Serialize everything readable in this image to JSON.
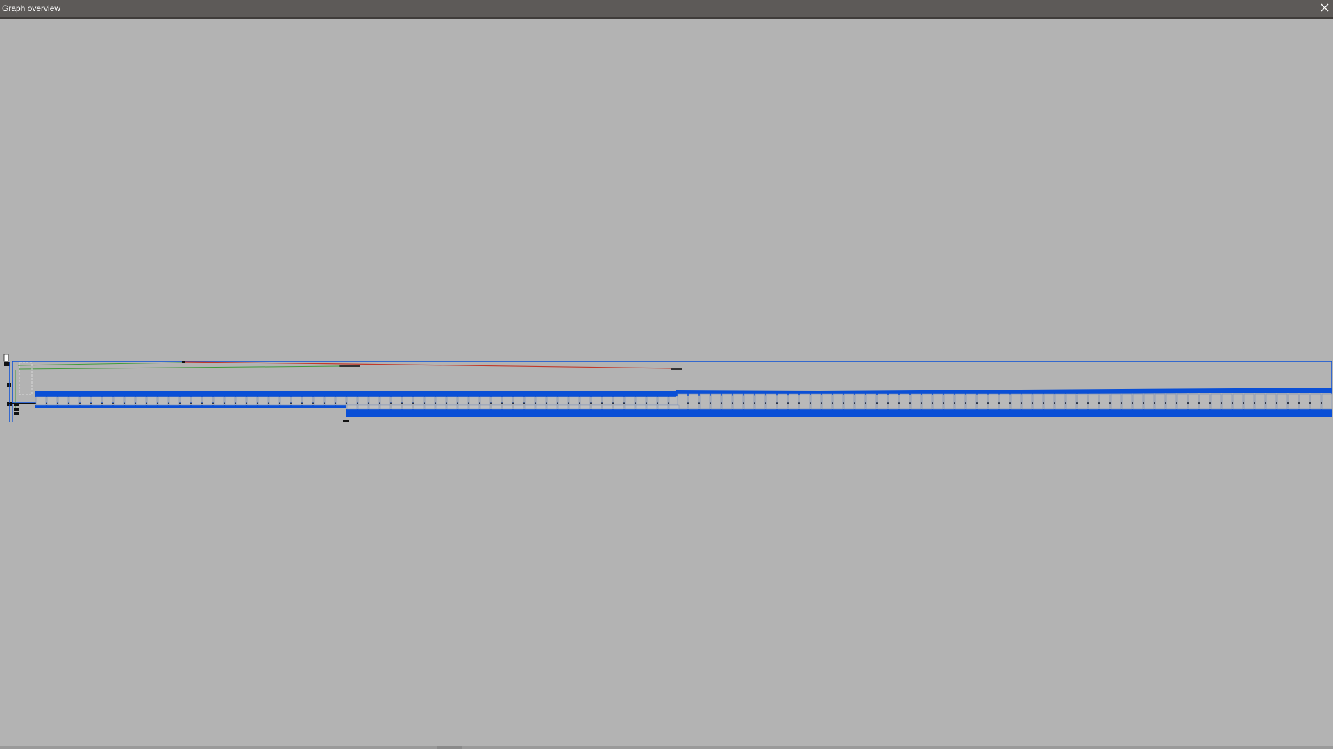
{
  "window": {
    "title": "Graph overview",
    "close_icon": "close-icon"
  },
  "colors": {
    "titlebar": "#5d5a58",
    "canvas": "#b3b3b3",
    "node_blue": "#0a4fd6",
    "link_red": "#c0392b",
    "link_green": "#3f9a3a",
    "trace_black": "#111111"
  }
}
